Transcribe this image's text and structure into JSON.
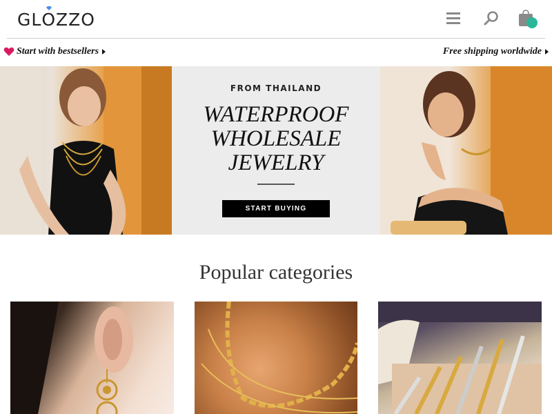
{
  "header": {
    "logo_text": "GLOZZO",
    "logo_prefix": "GL",
    "logo_o": "O",
    "logo_suffix": "ZZO",
    "icons": [
      "menu-icon",
      "search-icon",
      "cart-icon"
    ],
    "cart_badge_color": "#2bb89a"
  },
  "promo": {
    "left_label": "Start with bestsellers",
    "right_label": "Free shipping worldwide",
    "heart_color": "#d81b60"
  },
  "hero": {
    "kicker": "FROM THAILAND",
    "title_line1": "WATERPROOF",
    "title_line2": "WHOLESALE",
    "title_line3": "JEWELRY",
    "cta_label": "START BUYING"
  },
  "categories": {
    "title": "Popular categories",
    "items": [
      "earrings-photo",
      "necklaces-photo",
      "bracelets-photo"
    ]
  }
}
